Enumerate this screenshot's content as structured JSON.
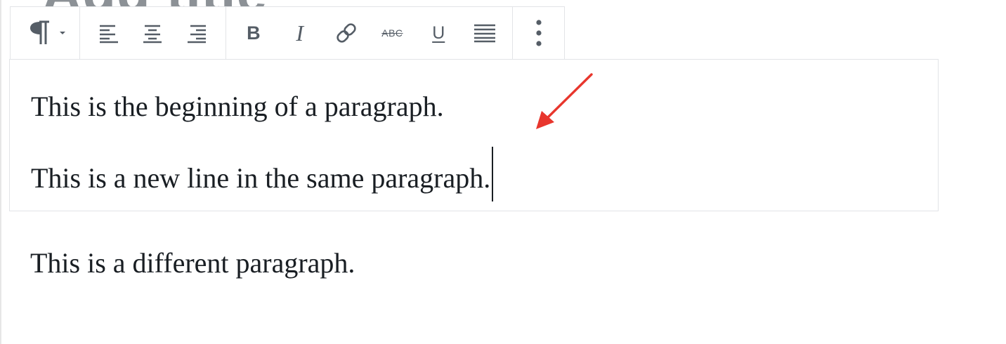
{
  "post_title": {
    "text": "Add title",
    "color": "#8c9196"
  },
  "toolbar": {
    "block_type": {
      "icon": "paragraph-icon",
      "dropdown_icon": "caret-down-icon"
    },
    "alignment": [
      {
        "icon": "align-left-icon"
      },
      {
        "icon": "align-center-icon"
      },
      {
        "icon": "align-right-icon"
      }
    ],
    "formatting": [
      {
        "icon": "bold-icon",
        "glyph": "B"
      },
      {
        "icon": "italic-icon",
        "glyph": "I"
      },
      {
        "icon": "link-icon"
      },
      {
        "icon": "strikethrough-icon",
        "glyph": "ABC"
      },
      {
        "icon": "underline-icon",
        "glyph": "U"
      },
      {
        "icon": "justify-icon"
      }
    ],
    "more": {
      "icon": "more-vertical-icon"
    }
  },
  "block": {
    "line1": "This is the beginning of a paragraph.",
    "line2": "This is a new line in the same paragraph."
  },
  "paragraph2": {
    "text": "This is a different paragraph."
  },
  "annotation": {
    "icon": "arrow-icon",
    "color": "#e8362d"
  }
}
